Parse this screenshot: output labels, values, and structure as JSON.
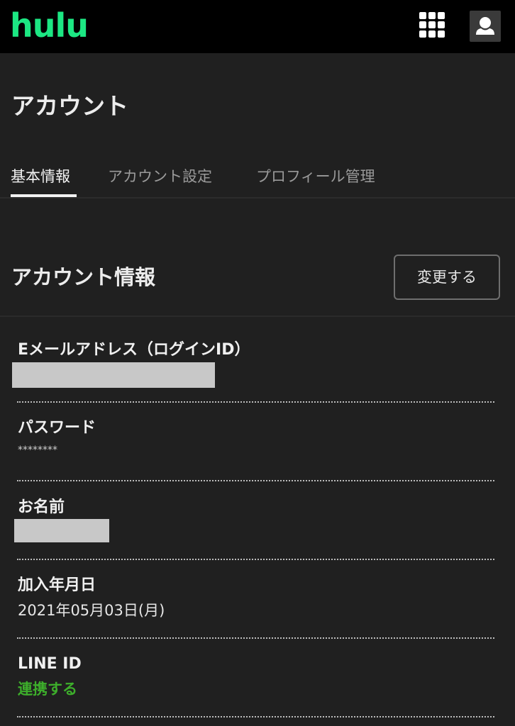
{
  "header": {
    "logo_text": "hulu",
    "logo_color": "#1ce783",
    "grid_icon": "grid-menu-icon",
    "profile_icon": "profile-avatar-icon"
  },
  "page": {
    "title": "アカウント"
  },
  "tabs": [
    {
      "label": "基本情報",
      "active": true
    },
    {
      "label": "アカウント設定",
      "active": false
    },
    {
      "label": "プロフィール管理",
      "active": false
    }
  ],
  "account_info": {
    "section_title": "アカウント情報",
    "change_button": "変更する",
    "fields": {
      "email": {
        "label": "Eメールアドレス（ログインID）"
      },
      "password": {
        "label": "パスワード",
        "value": "********"
      },
      "name": {
        "label": "お名前"
      },
      "join_date": {
        "label": "加入年月日",
        "value": "2021年05月03日(月)"
      },
      "line_id": {
        "label": "LINE ID",
        "link": "連携する"
      }
    }
  },
  "colors": {
    "background": "#202020",
    "topbar": "#000000",
    "link_green": "#3dae2b"
  }
}
